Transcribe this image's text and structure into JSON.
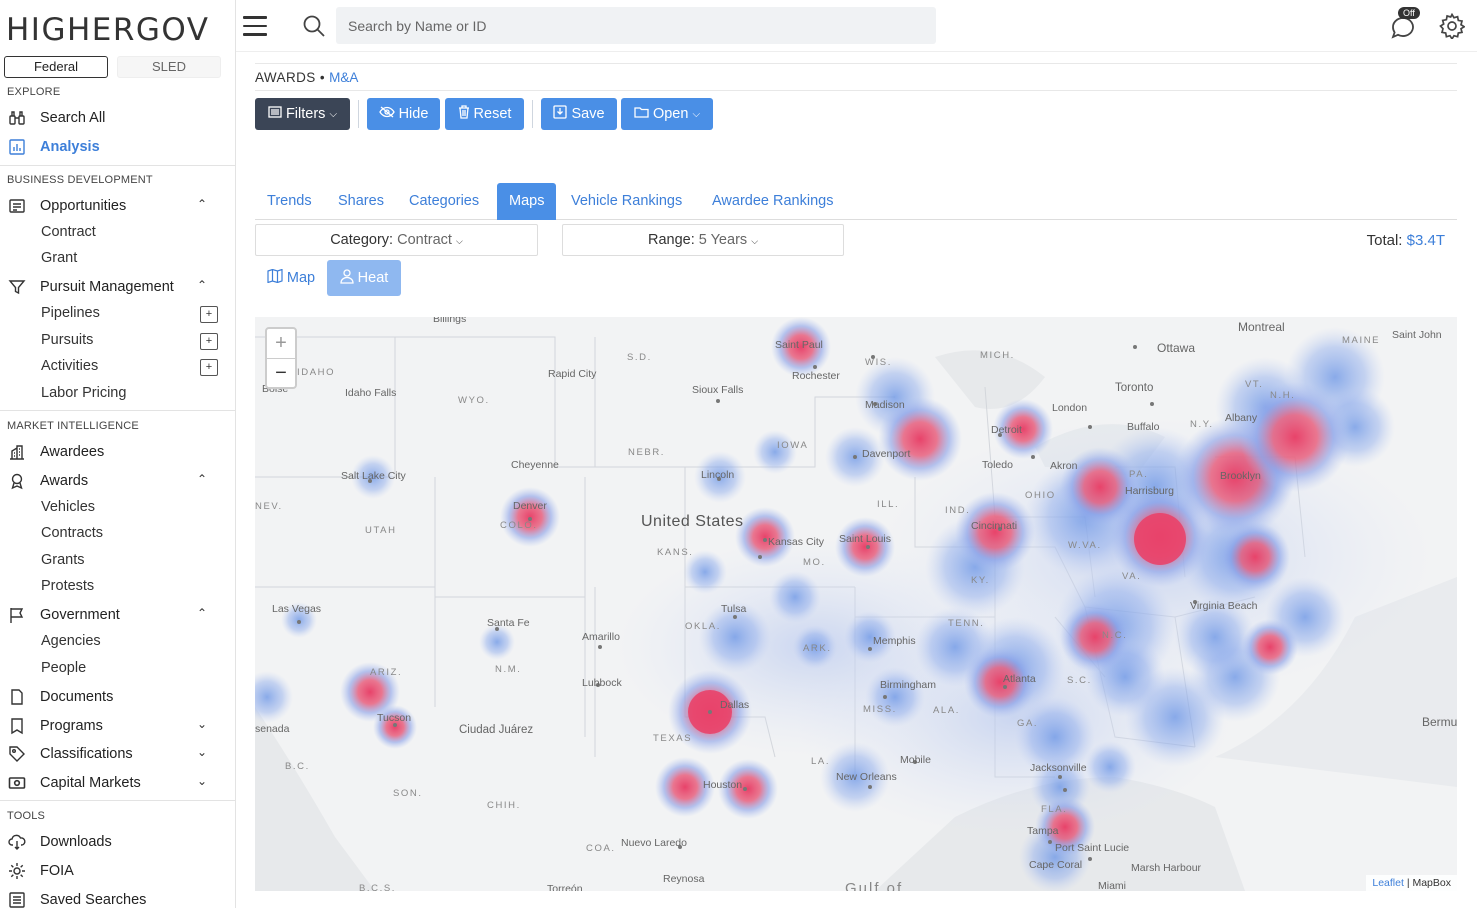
{
  "app": {
    "logo": "HIGHERGOV"
  },
  "sidebar": {
    "toggle": {
      "federal": "Federal",
      "sled": "SLED"
    },
    "sections": {
      "explore": "EXPLORE",
      "bizdev": "BUSINESS DEVELOPMENT",
      "market": "MARKET INTELLIGENCE",
      "tools": "TOOLS"
    },
    "explore": {
      "search_all": "Search All",
      "analysis": "Analysis"
    },
    "bizdev": {
      "opportunities": "Opportunities",
      "contract": "Contract",
      "grant": "Grant",
      "pursuit_mgmt": "Pursuit Management",
      "pipelines": "Pipelines",
      "pursuits": "Pursuits",
      "activities": "Activities",
      "labor_pricing": "Labor Pricing"
    },
    "market": {
      "awardees": "Awardees",
      "awards": "Awards",
      "vehicles": "Vehicles",
      "contracts": "Contracts",
      "grants": "Grants",
      "protests": "Protests",
      "government": "Government",
      "agencies": "Agencies",
      "people": "People",
      "documents": "Documents",
      "programs": "Programs",
      "classifications": "Classifications",
      "capital_markets": "Capital Markets"
    },
    "tools": {
      "downloads": "Downloads",
      "foia": "FOIA",
      "saved_searches": "Saved Searches"
    },
    "plus": "+"
  },
  "topbar": {
    "search_placeholder": "Search by Name or ID",
    "chat_badge": "Off"
  },
  "breadcrumb": {
    "root": "AWARDS",
    "sep": "•",
    "current": "M&A"
  },
  "toolbar": {
    "filters": "Filters",
    "hide": "Hide",
    "reset": "Reset",
    "save": "Save",
    "open": "Open"
  },
  "tabs": [
    "Trends",
    "Shares",
    "Categories",
    "Maps",
    "Vehicle Rankings",
    "Awardee Rankings"
  ],
  "selectors": {
    "category_label": "Category:",
    "category_value": "Contract",
    "range_label": "Range:",
    "range_value": "5 Years"
  },
  "total": {
    "label": "Total:",
    "value": "$3.4T"
  },
  "view": {
    "map": "Map",
    "heat": "Heat"
  },
  "map": {
    "zoom_in": "+",
    "zoom_out": "−",
    "attribution_leaflet": "Leaflet",
    "attribution_sep": "|",
    "attribution_mapbox": "MapBox",
    "labels": {
      "billings": "Billings",
      "montreal": "Montreal",
      "ottawa": "Ottawa",
      "saint_john": "Saint John",
      "maine": "MAINE",
      "saint_paul": "Saint Paul",
      "rochester": "Rochester",
      "sd": "S.D.",
      "wis": "WIS.",
      "mich": "MICH.",
      "idaho": "IDAHO",
      "idaho_falls": "Idaho Falls",
      "rapid_city": "Rapid City",
      "wyo": "WYO.",
      "sioux_falls": "Sioux Falls",
      "madison": "Madison",
      "toronto": "Toronto",
      "vt": "VT.",
      "london": "London",
      "boise": "Boise",
      "iowa": "IOWA",
      "detroit": "Detroit",
      "buffalo": "Buffalo",
      "albany": "Albany",
      "ny": "N.Y.",
      "nh": "N.H.",
      "nebr": "NEBR.",
      "davenport": "Davenport",
      "cheyenne": "Cheyenne",
      "toledo": "Toledo",
      "akron": "Akron",
      "salt_lake": "Salt Lake City",
      "lincoln": "Lincoln",
      "pa": "PA.",
      "harrisburg": "Harrisburg",
      "ohio": "OHIO",
      "brooklyn": "Brooklyn",
      "nev": "NEV.",
      "denver": "Denver",
      "colo": "COLO.",
      "ind": "IND.",
      "ill": "ILL.",
      "united_states": "United States",
      "utah": "UTAH",
      "cincinnati": "Cincinnati",
      "kansas_city": "Kansas City",
      "saint_louis": "Saint Louis",
      "kans": "KANS.",
      "wva": "W.VA.",
      "mo": "MO.",
      "va": "VA.",
      "ky": "KY.",
      "virginia_beach": "Virginia Beach",
      "las_vegas": "Las Vegas",
      "tulsa": "Tulsa",
      "santa_fe": "Santa Fe",
      "okla": "OKLA.",
      "amarillo": "Amarillo",
      "tenn": "TENN.",
      "nc": "N.C.",
      "memphis": "Memphis",
      "ark": "ARK.",
      "nm": "N.M.",
      "ariz": "ARIZ.",
      "lubbock": "Lubbock",
      "atlanta": "Atlanta",
      "sc": "S.C.",
      "birmingham": "Birmingham",
      "miss": "MISS.",
      "ala": "ALA.",
      "dallas": "Dallas",
      "ga": "GA.",
      "tucson": "Tucson",
      "senada": "senada",
      "ciudad_juarez": "Ciudad Juárez",
      "texas": "TEXAS",
      "bermu": "Bermu",
      "mobile": "Mobile",
      "la": "LA.",
      "jacksonville": "Jacksonville",
      "bc": "B.C.",
      "new_orleans": "New Orleans",
      "houston": "Houston",
      "son": "SON.",
      "chih": "CHIH.",
      "fla": "FLA.",
      "tampa": "Tampa",
      "port_saint_lucie": "Port Saint Lucie",
      "marsh_harbour": "Marsh Harbour",
      "nuevo_laredo": "Nuevo Laredo",
      "coa": "COA.",
      "cape_coral": "Cape Coral",
      "reynosa": "Reynosa",
      "miami": "Miami",
      "bcs": "B.C.S.",
      "torreon": "Torreón",
      "gulf": "Gulf of"
    },
    "heat_colors": {
      "low": "#6f98e6",
      "mid": "#8aa9ec",
      "high": "#e8436a"
    }
  },
  "colors": {
    "accent": "#4a8fe6",
    "dark_button": "#3b4556",
    "link": "#3d7fd9"
  }
}
